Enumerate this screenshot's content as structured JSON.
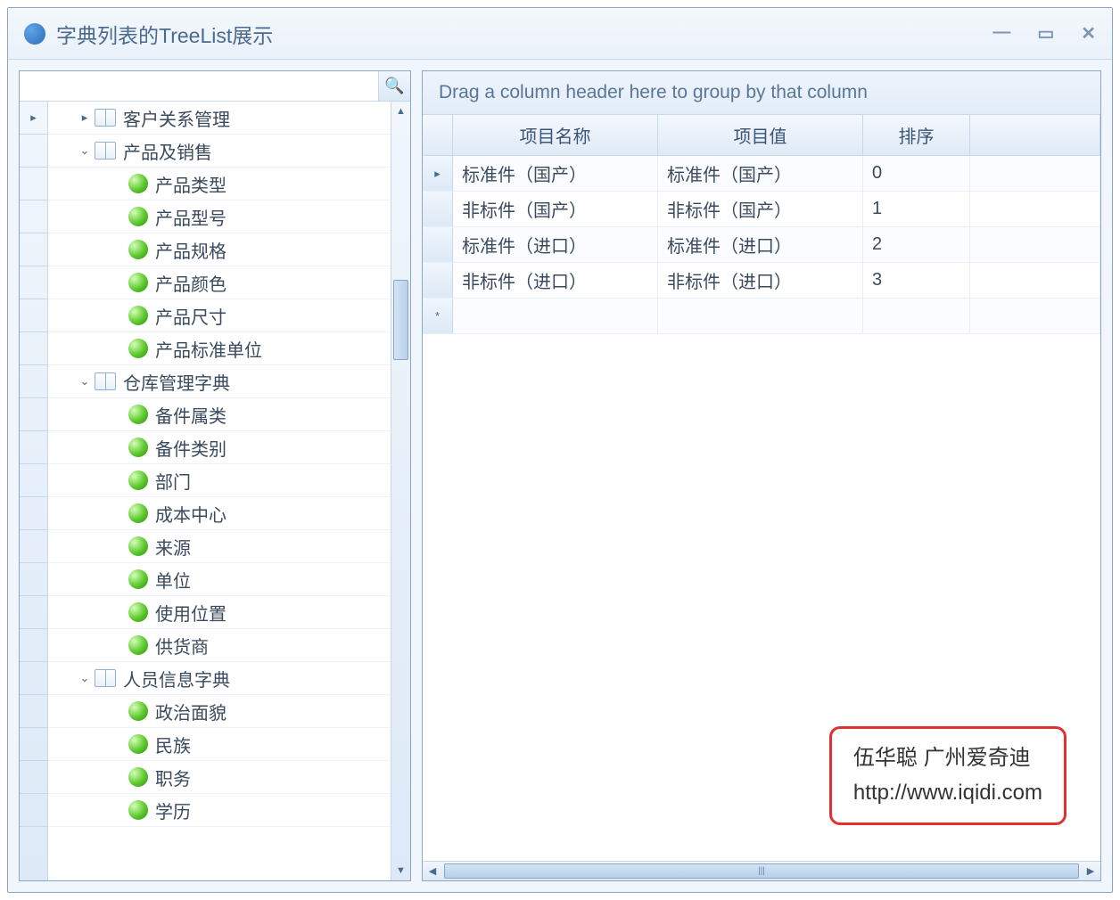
{
  "window": {
    "title": "字典列表的TreeList展示"
  },
  "search": {
    "placeholder": "",
    "value": ""
  },
  "tree": [
    {
      "type": "group",
      "expand": "▸",
      "icon": "book",
      "label": "客户关系管理",
      "rowmark": "▸"
    },
    {
      "type": "group",
      "expand": "⌄",
      "icon": "book",
      "label": "产品及销售"
    },
    {
      "type": "leaf",
      "icon": "ball",
      "label": "产品类型"
    },
    {
      "type": "leaf",
      "icon": "ball",
      "label": "产品型号"
    },
    {
      "type": "leaf",
      "icon": "ball",
      "label": "产品规格"
    },
    {
      "type": "leaf",
      "icon": "ball",
      "label": "产品颜色"
    },
    {
      "type": "leaf",
      "icon": "ball",
      "label": "产品尺寸"
    },
    {
      "type": "leaf",
      "icon": "ball",
      "label": "产品标准单位"
    },
    {
      "type": "group",
      "expand": "⌄",
      "icon": "book",
      "label": "仓库管理字典"
    },
    {
      "type": "leaf",
      "icon": "ball",
      "label": "备件属类"
    },
    {
      "type": "leaf",
      "icon": "ball",
      "label": "备件类别"
    },
    {
      "type": "leaf",
      "icon": "ball",
      "label": "部门"
    },
    {
      "type": "leaf",
      "icon": "ball",
      "label": "成本中心"
    },
    {
      "type": "leaf",
      "icon": "ball",
      "label": "来源"
    },
    {
      "type": "leaf",
      "icon": "ball",
      "label": "单位"
    },
    {
      "type": "leaf",
      "icon": "ball",
      "label": "使用位置"
    },
    {
      "type": "leaf",
      "icon": "ball",
      "label": "供货商"
    },
    {
      "type": "group",
      "expand": "⌄",
      "icon": "book",
      "label": "人员信息字典"
    },
    {
      "type": "leaf",
      "icon": "ball",
      "label": "政治面貌"
    },
    {
      "type": "leaf",
      "icon": "ball",
      "label": "民族"
    },
    {
      "type": "leaf",
      "icon": "ball",
      "label": "职务"
    },
    {
      "type": "leaf",
      "icon": "ball",
      "label": "学历"
    }
  ],
  "grid": {
    "group_hint": "Drag a column header here to group by that column",
    "headers": {
      "name": "项目名称",
      "value": "项目值",
      "sort": "排序"
    },
    "rows": [
      {
        "ind": "▸",
        "name": "标准件（国产）",
        "value": "标准件（国产）",
        "sort": "0"
      },
      {
        "ind": "",
        "name": "非标件（国产）",
        "value": "非标件（国产）",
        "sort": "1"
      },
      {
        "ind": "",
        "name": "标准件（进口）",
        "value": "标准件（进口）",
        "sort": "2"
      },
      {
        "ind": "",
        "name": "非标件（进口）",
        "value": "非标件（进口）",
        "sort": "3"
      },
      {
        "ind": "*",
        "name": "",
        "value": "",
        "sort": ""
      }
    ]
  },
  "watermark": {
    "line1": "伍华聪 广州爱奇迪",
    "line2": "http://www.iqidi.com"
  }
}
